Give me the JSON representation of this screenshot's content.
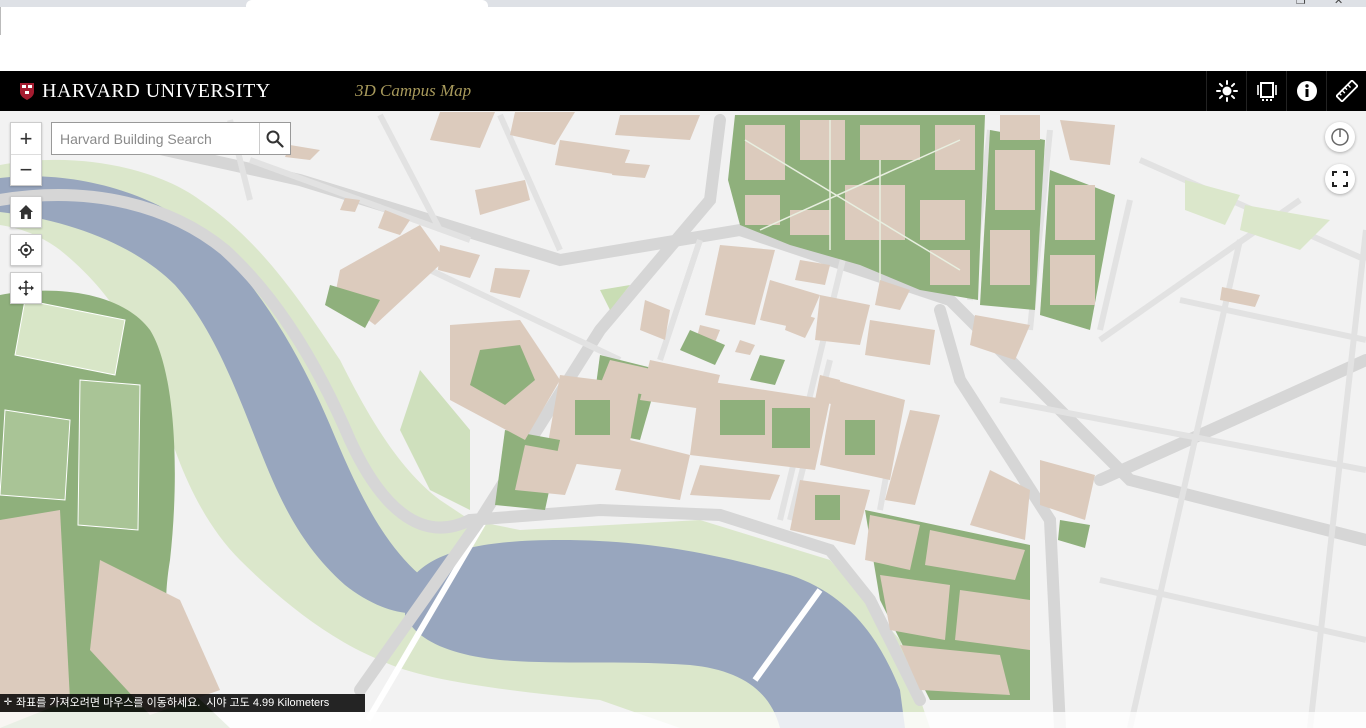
{
  "header": {
    "university_name": "HARVARD UNIVERSITY",
    "app_title": "3D Campus Map",
    "buttons": [
      "daylight-icon",
      "layers-icon",
      "info-icon",
      "measure-icon"
    ]
  },
  "search": {
    "placeholder": "Harvard Building Search"
  },
  "map_controls": {
    "zoom_in": "+",
    "zoom_out": "−"
  },
  "status": {
    "coordinate_hint": "좌표를 가져오려면 마우스를 이동하세요.",
    "altitude": "시야 고도 4.99 Kilometers"
  },
  "colors": {
    "header_bg": "#000000",
    "title_gold": "#a89a5c",
    "water": "#98a6be",
    "building": "#dccbbd",
    "green": "#8fb07c",
    "light_green": "#d8e6c7",
    "road": "#d6d6d6",
    "land": "#f2f2f2"
  }
}
